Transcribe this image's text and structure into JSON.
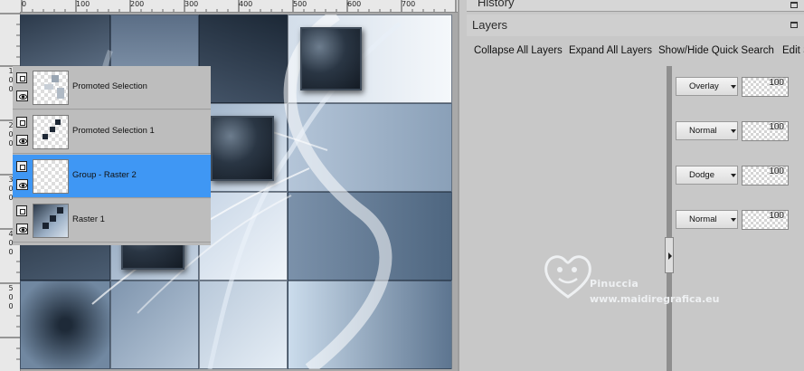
{
  "rulers": {
    "top_labels": [
      "0",
      "100",
      "200",
      "300",
      "400",
      "500",
      "600",
      "700"
    ],
    "left_labels": [
      "1",
      "0",
      "0",
      "2",
      "0",
      "0",
      "3",
      "0",
      "0",
      "4",
      "0",
      "0",
      "5",
      "0",
      "0"
    ]
  },
  "panels": {
    "history_title": "History",
    "layers_title": "Layers",
    "toolbar": {
      "collapse_all": "Collapse All Layers",
      "expand_all": "Expand All Layers",
      "quick_search": "Show/Hide Quick Search",
      "edit": "Edit S"
    }
  },
  "layers": [
    {
      "name": "Promoted Selection",
      "blend": "Overlay",
      "opacity": "100",
      "selected": false
    },
    {
      "name": "Promoted Selection 1",
      "blend": "Normal",
      "opacity": "100",
      "selected": false
    },
    {
      "name": "Group - Raster 2",
      "blend": "Dodge",
      "opacity": "100",
      "selected": true
    },
    {
      "name": "Raster 1",
      "blend": "Normal",
      "opacity": "100",
      "selected": false
    }
  ],
  "watermark": {
    "name": "Pinuccia",
    "url": "www.maidiregrafica.eu"
  },
  "colors": {
    "selected_row": "#3f97f4",
    "panel_bg": "#c8c8c8",
    "canvas_dark": "#1f2c3a",
    "canvas_light": "#dfe8f2"
  }
}
